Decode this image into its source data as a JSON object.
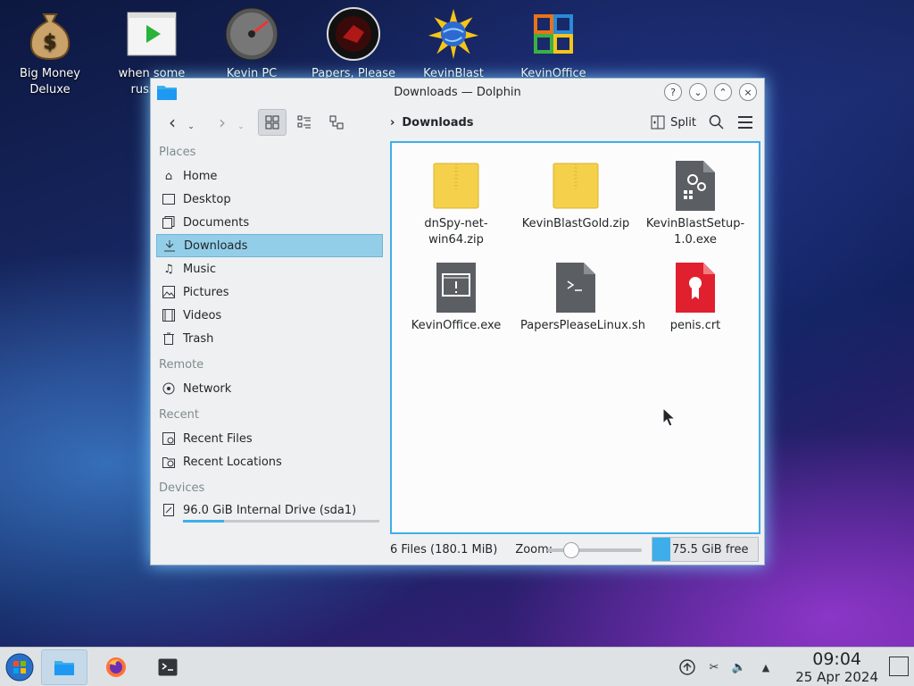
{
  "desktop": {
    "icons": [
      {
        "label": "Big Money Deluxe",
        "icon": "money-bag-icon"
      },
      {
        "label": "when some russian",
        "icon": "video-play-icon"
      },
      {
        "label": "Kevin PC",
        "icon": "speedometer-icon"
      },
      {
        "label": "Papers, Please",
        "icon": "papers-please-icon"
      },
      {
        "label": "KevinBlast",
        "icon": "globe-star-icon"
      },
      {
        "label": "KevinOffice",
        "icon": "office-grid-icon"
      }
    ]
  },
  "window": {
    "title": "Downloads — Dolphin",
    "buttons": [
      "?",
      "⌄",
      "⌃",
      "×"
    ]
  },
  "toolbar": {
    "breadcrumb": "Downloads",
    "split_label": "Split"
  },
  "places": {
    "places_header": "Places",
    "items": [
      {
        "label": "Home",
        "icon": "home-icon"
      },
      {
        "label": "Desktop",
        "icon": "desktop-icon"
      },
      {
        "label": "Documents",
        "icon": "documents-icon"
      },
      {
        "label": "Downloads",
        "icon": "downloads-icon"
      },
      {
        "label": "Music",
        "icon": "music-icon"
      },
      {
        "label": "Pictures",
        "icon": "pictures-icon"
      },
      {
        "label": "Videos",
        "icon": "videos-icon"
      },
      {
        "label": "Trash",
        "icon": "trash-icon"
      }
    ],
    "remote_header": "Remote",
    "remote_items": [
      {
        "label": "Network",
        "icon": "network-icon"
      }
    ],
    "recent_header": "Recent",
    "recent_items": [
      {
        "label": "Recent Files",
        "icon": "recent-files-icon"
      },
      {
        "label": "Recent Locations",
        "icon": "recent-locations-icon"
      }
    ],
    "devices_header": "Devices",
    "devices": [
      {
        "label": "96.0 GiB Internal Drive (sda1)",
        "icon": "drive-icon",
        "used_fraction": 0.21
      }
    ]
  },
  "files": [
    {
      "name": "dnSpy-net-win64.zip",
      "type": "zip"
    },
    {
      "name": "KevinBlastGold.zip",
      "type": "zip"
    },
    {
      "name": "KevinBlastSetup-1.0.exe",
      "type": "exe-setup"
    },
    {
      "name": "KevinOffice.exe",
      "type": "exe"
    },
    {
      "name": "PapersPleaseLinux.sh",
      "type": "script"
    },
    {
      "name": "penis.crt",
      "type": "certificate"
    }
  ],
  "status": {
    "summary": "6 Files (180.1 MiB)",
    "zoom_label": "Zoom:",
    "free_space": "75.5 GiB free"
  },
  "taskbar": {
    "time": "09:04",
    "date": "25 Apr 2024"
  },
  "colors": {
    "accent": "#3daee9",
    "selection": "#93cee9",
    "zip_folder": "#f5d04a",
    "cert_red": "#e0202e"
  }
}
